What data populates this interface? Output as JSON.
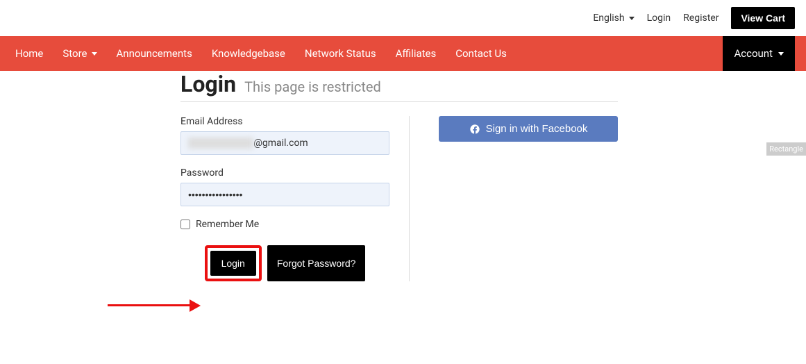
{
  "topbar": {
    "language": "English",
    "login": "Login",
    "register": "Register",
    "view_cart": "View Cart"
  },
  "nav": {
    "home": "Home",
    "store": "Store",
    "announcements": "Announcements",
    "knowledgebase": "Knowledgebase",
    "network_status": "Network Status",
    "affiliates": "Affiliates",
    "contact": "Contact Us",
    "account": "Account"
  },
  "page": {
    "title": "Login",
    "subtitle": "This page is restricted"
  },
  "form": {
    "email_label": "Email Address",
    "email_suffix": "@gmail.com",
    "password_label": "Password",
    "password_value": "••••••••••••••••",
    "remember": "Remember Me",
    "login_btn": "Login",
    "forgot_btn": "Forgot Password?"
  },
  "social": {
    "facebook": "Sign in with Facebook"
  },
  "badge": {
    "rect": "Rectangle"
  }
}
